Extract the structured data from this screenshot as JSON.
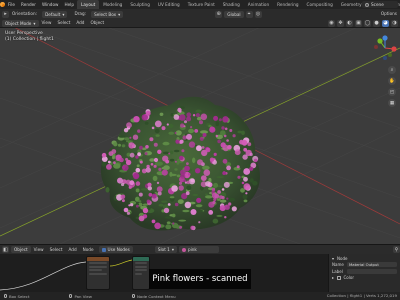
{
  "menu": {
    "items": [
      "File",
      "Render",
      "Window",
      "Help"
    ],
    "workspaces": [
      "Layout",
      "Modeling",
      "Sculpting",
      "UV Editing",
      "Texture Paint",
      "Shading",
      "Animation",
      "Rendering",
      "Compositing",
      "Geometry Nodes",
      "Scripting"
    ],
    "active_workspace": "Layout",
    "scene_label": "Scene"
  },
  "viewport_header": {
    "orientation_label": "Orientation:",
    "orientation_value": "Default",
    "drag_label": "Drag:",
    "drag_value": "Select Box",
    "pivot_value": "Global",
    "options_label": "Options"
  },
  "viewport_header2": {
    "mode_value": "Object Mode",
    "menu_items": [
      "View",
      "Select",
      "Add",
      "Object"
    ]
  },
  "viewport": {
    "view_name": "User Perspective",
    "collection_info": "(1) Collection | flight1"
  },
  "node_editor": {
    "editor_type": "Object",
    "menu_items": [
      "View",
      "Select",
      "Add",
      "Node"
    ],
    "use_nodes_label": "Use Nodes",
    "slot_value": "Slot 1",
    "material_name": "pink"
  },
  "side_panel": {
    "section": "Node",
    "name_label": "Name",
    "name_value": "Material Output",
    "label_label": "Label",
    "color_label": "Color"
  },
  "caption": "Pink flowers - scanned",
  "status_bar": {
    "select_label": "Box Select",
    "pan_label": "Pan View",
    "context_label": "Node Context Menu",
    "info_right": "Collection | flight1 | Verts 1,272,019"
  },
  "colors": {
    "accent": "#4772b3",
    "active_tab": "#3a3a3a",
    "viewport_bg": "#3c3c3c",
    "x_axis": "#9a3a3a",
    "y_axis": "#7a9a2a"
  }
}
